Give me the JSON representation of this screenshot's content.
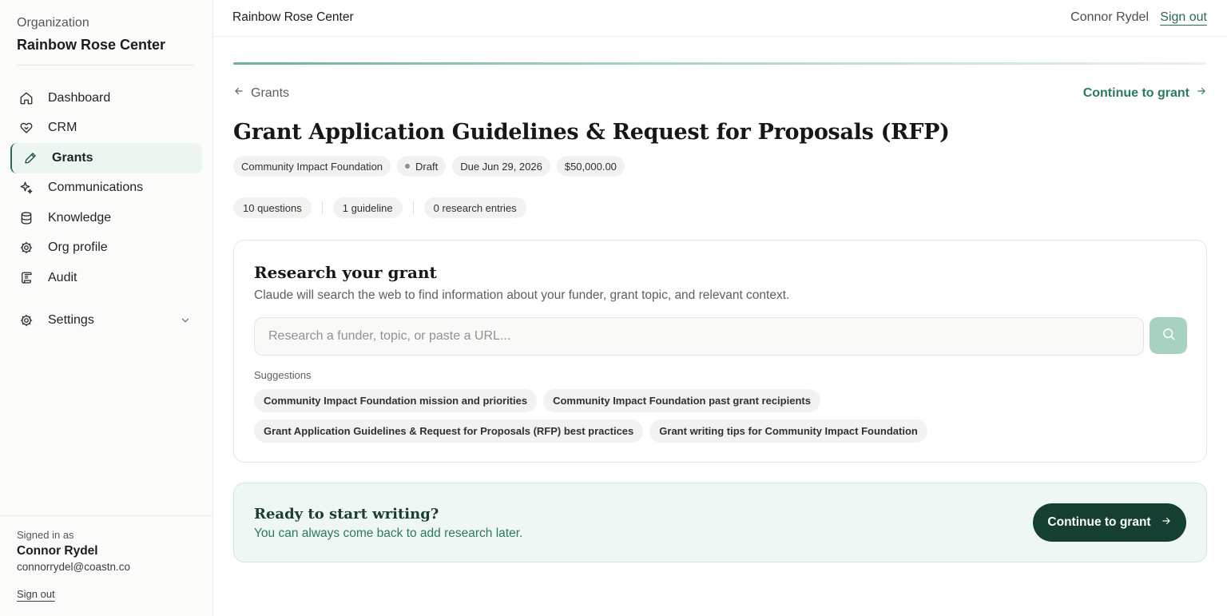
{
  "sidebar": {
    "org_caption": "Organization",
    "org_name": "Rainbow Rose Center",
    "nav": [
      {
        "label": "Dashboard",
        "icon": "home-icon"
      },
      {
        "label": "CRM",
        "icon": "handshake-icon"
      },
      {
        "label": "Grants",
        "icon": "pen-icon",
        "active": true
      },
      {
        "label": "Communications",
        "icon": "sparkle-icon"
      },
      {
        "label": "Knowledge",
        "icon": "database-icon"
      },
      {
        "label": "Org profile",
        "icon": "gear-icon"
      },
      {
        "label": "Audit",
        "icon": "scroll-icon"
      }
    ],
    "settings_label": "Settings",
    "signed_in_caption": "Signed in as",
    "user_name": "Connor Rydel",
    "user_email": "connorrydel@coastn.co",
    "sign_out": "Sign out"
  },
  "topbar": {
    "title": "Rainbow Rose Center",
    "user": "Connor Rydel",
    "sign_out": "Sign out"
  },
  "main": {
    "back_label": "Grants",
    "continue_label": "Continue to grant",
    "title": "Grant Application Guidelines & Request for Proposals (RFP)",
    "chips": {
      "funder": "Community Impact Foundation",
      "status": "Draft",
      "due": "Due Jun 29, 2026",
      "amount": "$50,000.00"
    },
    "stats": {
      "questions": "10 questions",
      "guidelines": "1 guideline",
      "research": "0 research entries"
    },
    "progress_fraction": 1.0
  },
  "research": {
    "title": "Research your grant",
    "subtitle": "Claude will search the web to find information about your funder, grant topic, and relevant context.",
    "placeholder": "Research a funder, topic, or paste a URL...",
    "value": "",
    "suggestions_label": "Suggestions",
    "suggestions": [
      "Community Impact Foundation mission and priorities",
      "Community Impact Foundation past grant recipients",
      "Grant Application Guidelines & Request for Proposals (RFP) best practices",
      "Grant writing tips for Community Impact Foundation"
    ]
  },
  "ready": {
    "title": "Ready to start writing?",
    "subtitle": "You can always come back to add research later.",
    "button": "Continue to grant"
  },
  "colors": {
    "accent": "#2a7a5c",
    "dark_button": "#143f32",
    "active_nav_bg": "#edf5f1",
    "ready_bg": "#eef7f3",
    "search_button": "#a8d2c0"
  }
}
